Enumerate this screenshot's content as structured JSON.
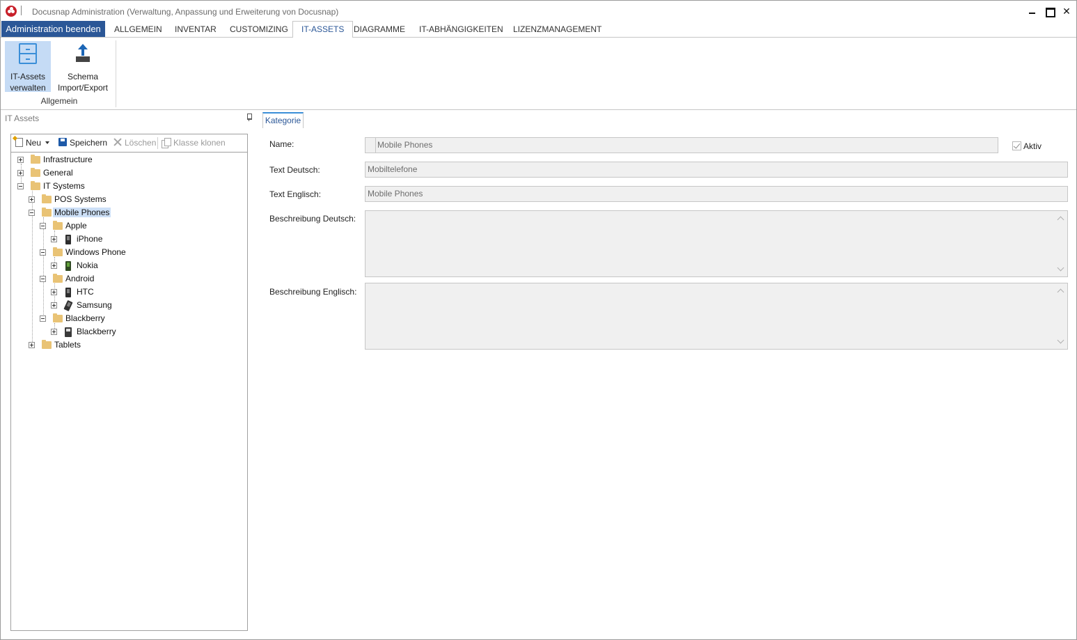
{
  "window": {
    "title": "Docusnap Administration (Verwaltung, Anpassung und Erweiterung von Docusnap)",
    "close_glyph": "✕"
  },
  "ribbon": {
    "file_tab": "Administration beenden",
    "tabs": [
      {
        "label": "ALLGEMEIN"
      },
      {
        "label": "INVENTAR"
      },
      {
        "label": "CUSTOMIZING"
      },
      {
        "label": "IT-ASSETS",
        "active": true
      },
      {
        "label": "DIAGRAMME"
      },
      {
        "label": "IT-ABHÄNGIGKEITEN"
      },
      {
        "label": "LIZENZMANAGEMENT"
      }
    ],
    "buttons": [
      {
        "label": "IT-Assets\nverwalten",
        "icon": "file-cabinet-icon",
        "selected": true
      },
      {
        "label": "Schema\nImport/Export",
        "icon": "upload-icon"
      }
    ],
    "group_label": "Allgemein"
  },
  "left_panel": {
    "caption": "IT Assets",
    "toolbar": {
      "new_label": "Neu",
      "save_label": "Speichern",
      "delete_label": "Löschen",
      "clone_label": "Klasse klonen"
    },
    "tree": [
      {
        "label": "Infrastructure",
        "icon": "folder-icon"
      },
      {
        "label": "General",
        "icon": "folder-icon"
      },
      {
        "label": "IT Systems",
        "icon": "folder-icon",
        "expanded": true
      },
      {
        "label": "POS Systems",
        "icon": "folder-icon"
      },
      {
        "label": "Mobile Phones",
        "icon": "folder-icon",
        "selected": true,
        "expanded": true
      },
      {
        "label": "Apple",
        "icon": "folder-icon"
      },
      {
        "label": "iPhone",
        "icon": "phone-icon"
      },
      {
        "label": "Windows Phone",
        "icon": "folder-icon"
      },
      {
        "label": "Nokia",
        "icon": "phone-icon"
      },
      {
        "label": "Android",
        "icon": "folder-icon"
      },
      {
        "label": "HTC",
        "icon": "phone-icon"
      },
      {
        "label": "Samsung",
        "icon": "phone-icon"
      },
      {
        "label": "Blackberry",
        "icon": "folder-icon"
      },
      {
        "label": "Blackberry",
        "icon": "phone-icon"
      },
      {
        "label": "Tablets",
        "icon": "folder-icon"
      }
    ]
  },
  "detail": {
    "tab": "Kategorie",
    "fields": {
      "name_label": "Name:",
      "name_value": "Mobile Phones",
      "text_de_label": "Text Deutsch:",
      "text_de_value": "Mobiltelefone",
      "text_en_label": "Text Englisch:",
      "text_en_value": "Mobile Phones",
      "desc_de_label": "Beschreibung Deutsch:",
      "desc_de_value": "",
      "desc_en_label": "Beschreibung Englisch:",
      "desc_en_value": ""
    },
    "aktiv_label": "Aktiv",
    "aktiv_checked": true
  }
}
